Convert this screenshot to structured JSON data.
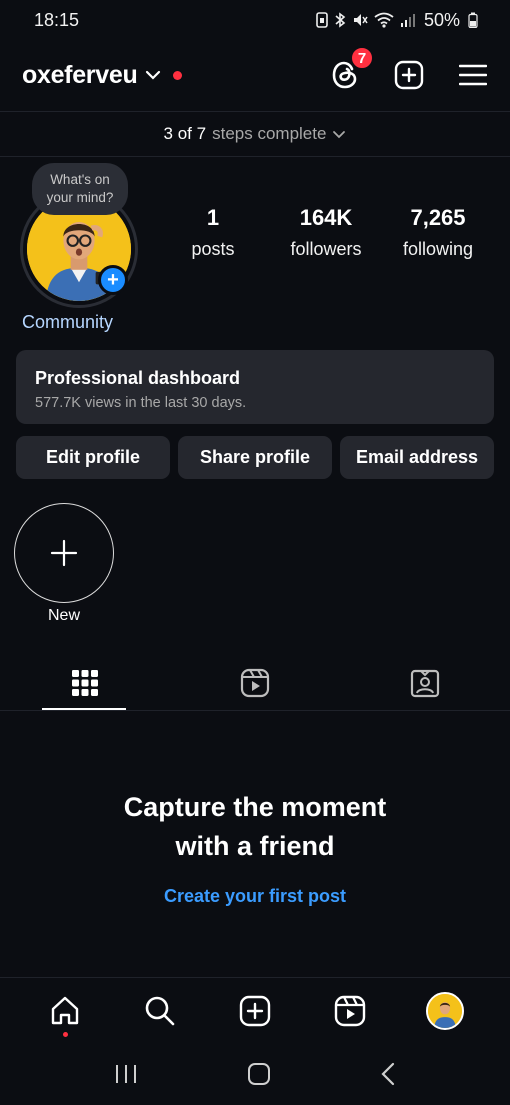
{
  "status_bar": {
    "time": "18:15",
    "battery": "50%"
  },
  "header": {
    "username": "oxeferveu",
    "threads_badge": "7",
    "icons": [
      "threads-icon",
      "add-icon",
      "menu-icon"
    ]
  },
  "steps": {
    "done": "3 of 7",
    "label": "steps complete"
  },
  "profile": {
    "thought_bubble": "What's on your mind?",
    "community_label": "Community",
    "stats": [
      {
        "value": "1",
        "label": "posts"
      },
      {
        "value": "164K",
        "label": "followers"
      },
      {
        "value": "7,265",
        "label": "following"
      }
    ]
  },
  "dashboard": {
    "title": "Professional dashboard",
    "subtitle": "577.7K views in the last 30 days."
  },
  "actions": [
    {
      "label": "Edit profile"
    },
    {
      "label": "Share profile"
    },
    {
      "label": "Email address"
    }
  ],
  "highlights": {
    "new_label": "New"
  },
  "tabs": [
    "grid-icon",
    "reels-icon",
    "tagged-icon"
  ],
  "empty_state": {
    "headline_line1": "Capture the moment",
    "headline_line2": "with a friend",
    "link": "Create your first post"
  },
  "bottom_nav": [
    "home-icon",
    "search-icon",
    "create-icon",
    "reels-icon",
    "profile-avatar"
  ],
  "colors": {
    "background": "#0b0d12",
    "accent_blue": "#3b9cff",
    "notification_red": "#ff3040",
    "card": "#25272e"
  }
}
